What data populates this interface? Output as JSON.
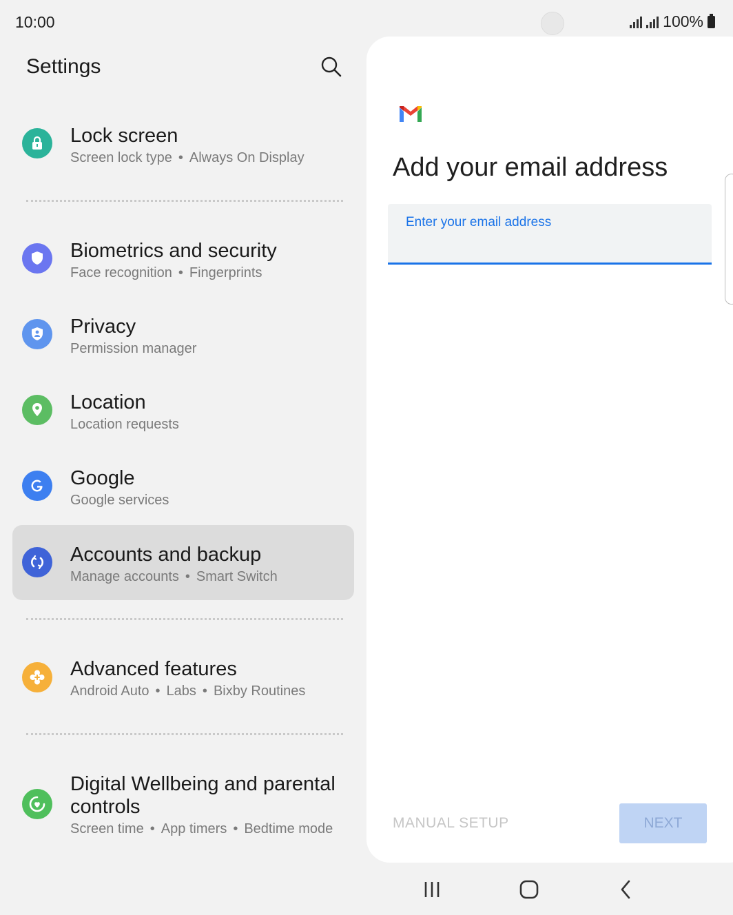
{
  "status_bar": {
    "time": "10:00",
    "battery": "100%"
  },
  "settings": {
    "title": "Settings",
    "items": [
      {
        "title": "Lock screen",
        "subs": [
          "Screen lock type",
          "Always On Display"
        ],
        "color": "#2bb39a",
        "icon": "lock-icon"
      },
      {
        "title": "Biometrics and security",
        "subs": [
          "Face recognition",
          "Fingerprints"
        ],
        "color": "#6b76f0",
        "icon": "shield-icon"
      },
      {
        "title": "Privacy",
        "subs": [
          "Permission manager"
        ],
        "color": "#5f95ee",
        "icon": "privacy-shield-icon"
      },
      {
        "title": "Location",
        "subs": [
          "Location requests"
        ],
        "color": "#5cbd63",
        "icon": "location-pin-icon"
      },
      {
        "title": "Google",
        "subs": [
          "Google services"
        ],
        "color": "#3d7ff0",
        "icon": "google-icon"
      },
      {
        "title": "Accounts and backup",
        "subs": [
          "Manage accounts",
          "Smart Switch"
        ],
        "color": "#3f63d8",
        "icon": "sync-icon"
      },
      {
        "title": "Advanced features",
        "subs": [
          "Android Auto",
          "Labs",
          "Bixby Routines"
        ],
        "color": "#f6b03a",
        "icon": "gear-plus-icon"
      },
      {
        "title_line1": "Digital Wellbeing and parental",
        "title_line2": "controls",
        "subs": [
          "Screen time",
          "App timers",
          "Bedtime mode"
        ],
        "color": "#4fbf5c",
        "icon": "wellbeing-icon"
      }
    ]
  },
  "gmail": {
    "heading": "Add your email address",
    "email_placeholder": "Enter your email address",
    "manual_setup": "MANUAL SETUP",
    "next": "NEXT"
  },
  "sep": "•"
}
